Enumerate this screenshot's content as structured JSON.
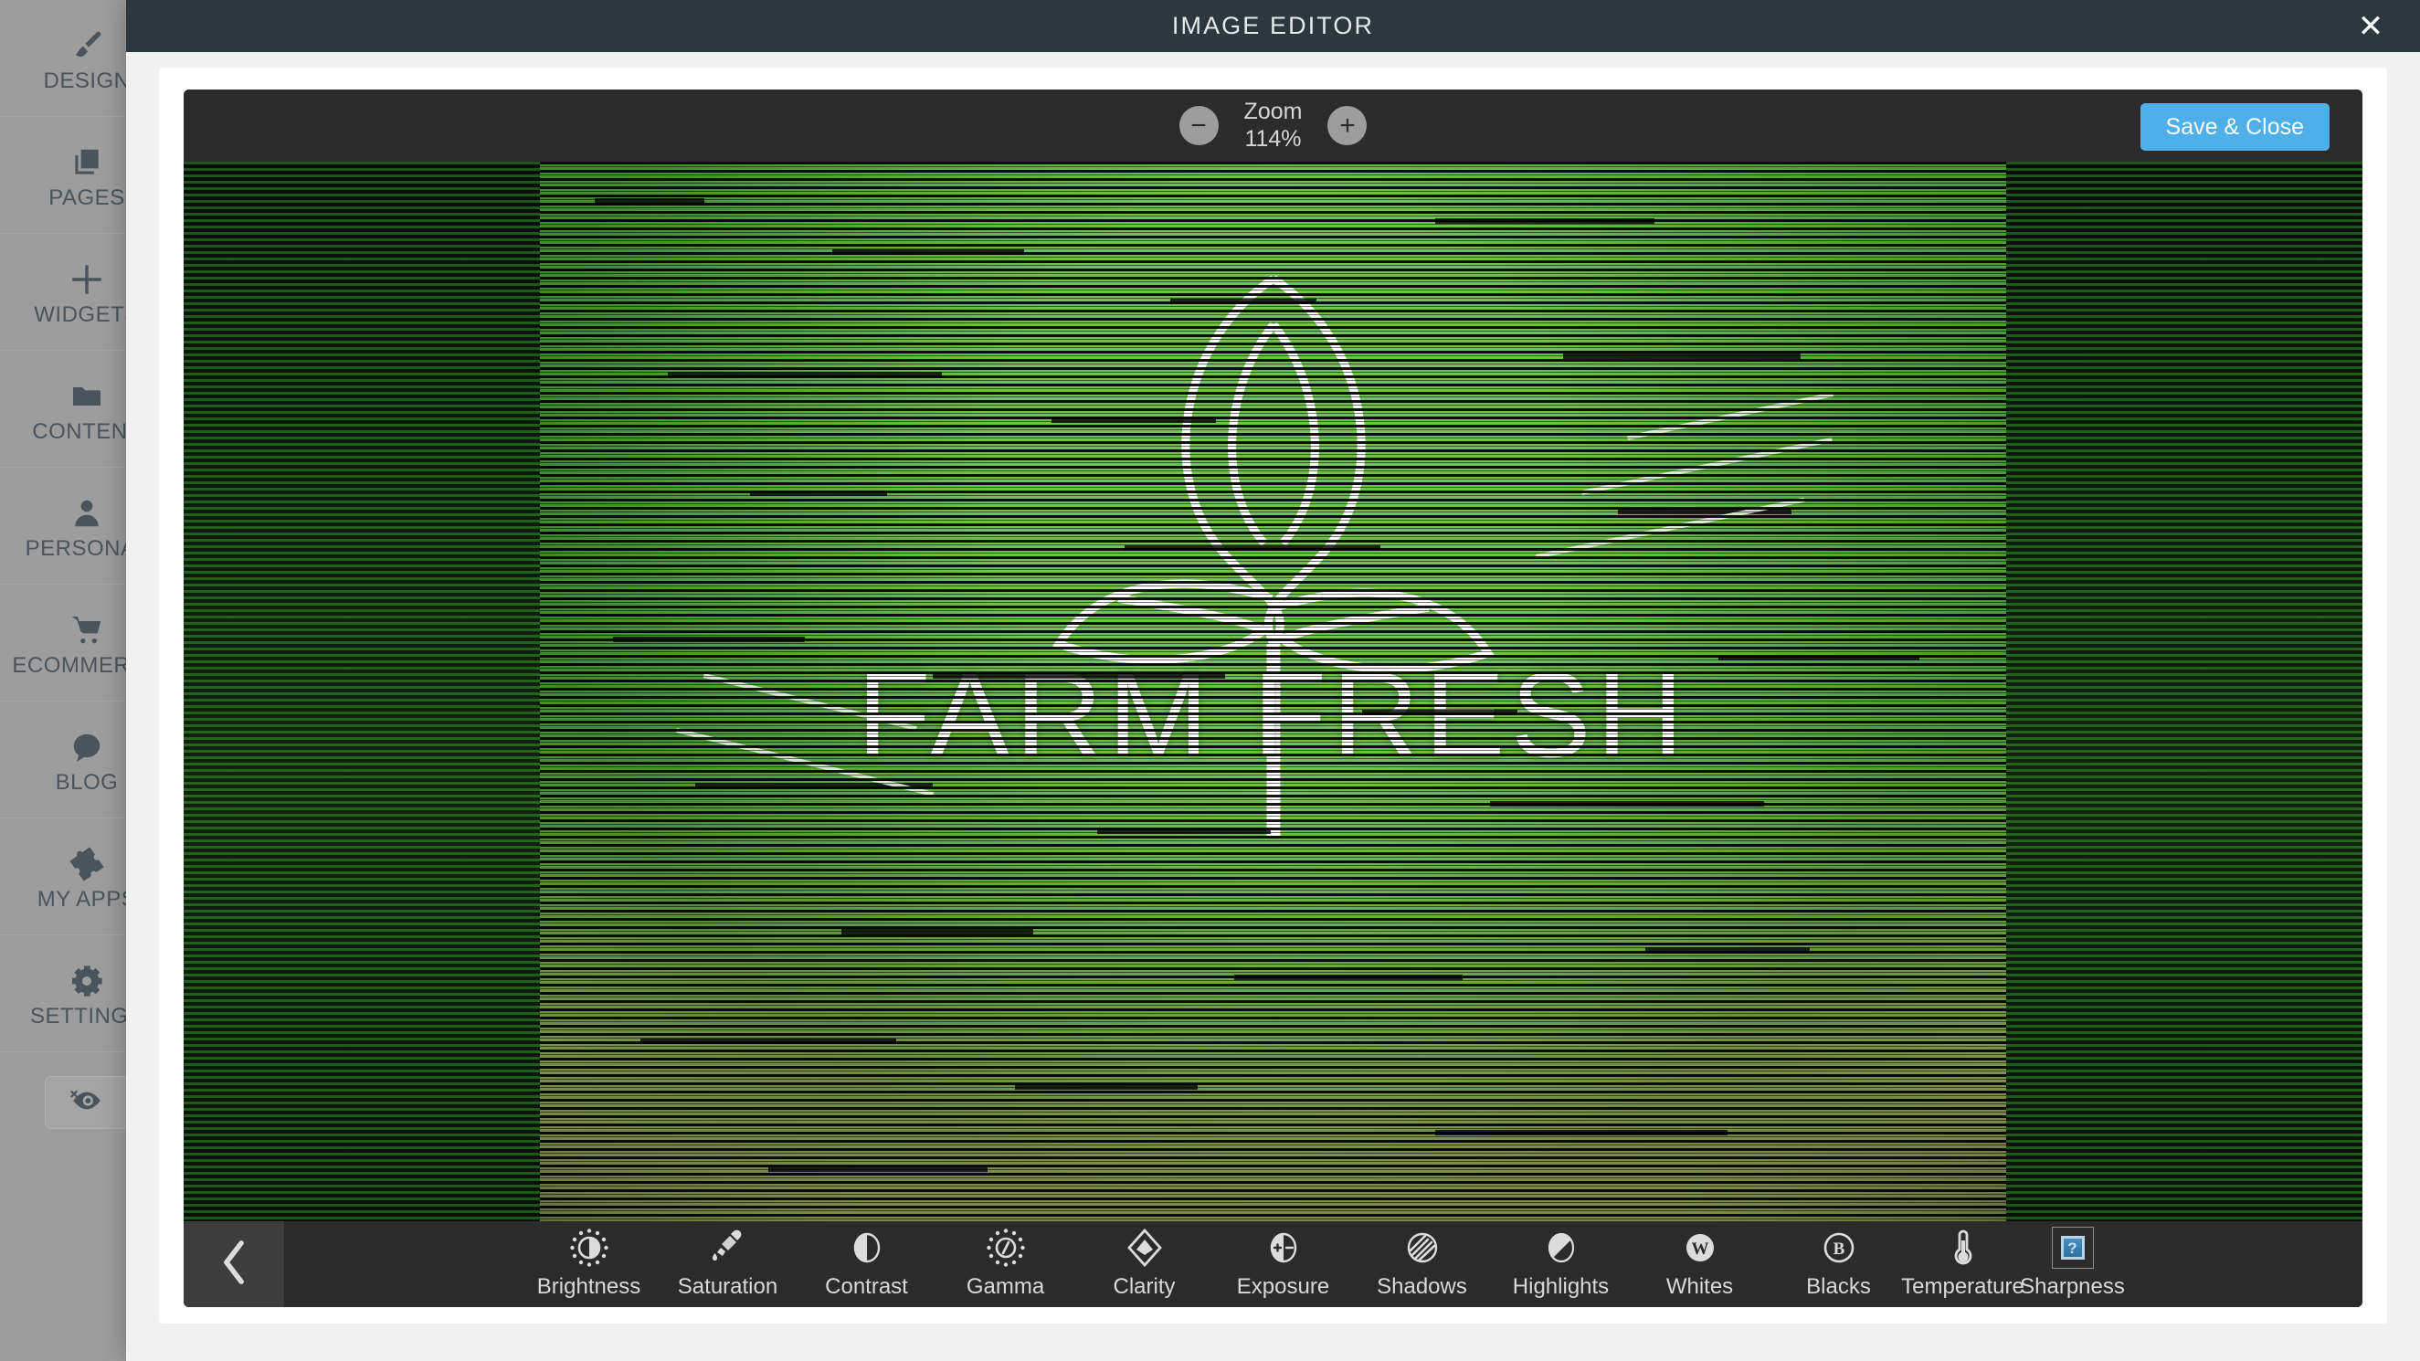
{
  "background": {
    "sidebar": {
      "items": [
        {
          "label": "DESIGN",
          "icon": "paintbrush-icon"
        },
        {
          "label": "PAGES",
          "icon": "pages-icon"
        },
        {
          "label": "WIDGETS",
          "icon": "plus-icon"
        },
        {
          "label": "CONTENT",
          "icon": "folder-icon"
        },
        {
          "label": "PERSONAL",
          "icon": "person-icon"
        },
        {
          "label": "ECOMMERCE",
          "icon": "cart-icon"
        },
        {
          "label": "BLOG",
          "icon": "speech-bubble-icon"
        },
        {
          "label": "MY APPS",
          "icon": "puzzle-piece-icon"
        },
        {
          "label": "SETTINGS",
          "icon": "gear-icon"
        }
      ],
      "preview_toggle_icon": "eye-off-icon"
    },
    "remove_badge_icon": "close-x-icon",
    "accent_green": "#225d4a",
    "accent_blue": "#2f6eb5",
    "badge_red": "#b33a34"
  },
  "modal": {
    "title": "IMAGE EDITOR",
    "close_icon": "close-x-icon",
    "header_bg": "#2b383d"
  },
  "toolbar": {
    "zoom_label": "Zoom",
    "zoom_value": "114%",
    "zoom_out_icon": "minus-circle-icon",
    "zoom_in_icon": "plus-circle-icon",
    "save_label": "Save & Close",
    "save_color": "#4fafe8"
  },
  "canvas": {
    "image_caption": "FARM FRESH",
    "image_alt": "Farm Fresh leaf sprout logo over green produce photo"
  },
  "tools": {
    "back_icon": "chevron-left-icon",
    "items": [
      {
        "label": "Brightness",
        "icon": "brightness-icon"
      },
      {
        "label": "Saturation",
        "icon": "eyedropper-icon"
      },
      {
        "label": "Contrast",
        "icon": "contrast-icon"
      },
      {
        "label": "Gamma",
        "icon": "gamma-dial-icon"
      },
      {
        "label": "Clarity",
        "icon": "diamond-icon"
      },
      {
        "label": "Exposure",
        "icon": "exposure-icon"
      },
      {
        "label": "Shadows",
        "icon": "shadows-icon"
      },
      {
        "label": "Highlights",
        "icon": "highlights-icon"
      },
      {
        "label": "Whites",
        "icon": "whites-w-icon"
      },
      {
        "label": "Blacks",
        "icon": "blacks-b-icon"
      },
      {
        "label": "Temperature",
        "icon": "thermometer-icon"
      },
      {
        "label": "Sharpness",
        "icon": "broken-image-icon"
      }
    ]
  }
}
